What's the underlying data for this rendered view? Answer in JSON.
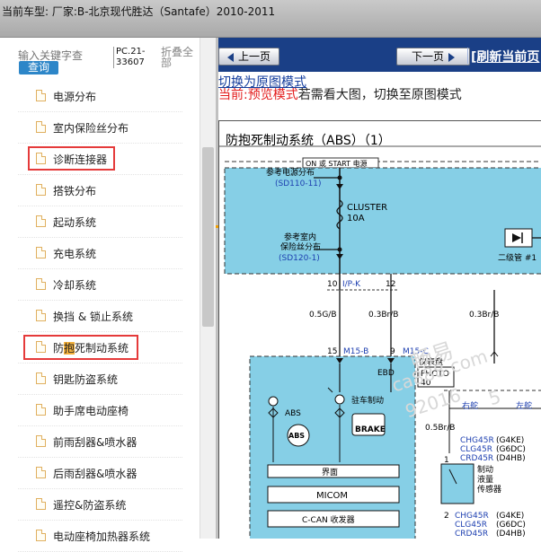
{
  "header": {
    "title": "当前车型:   厂家:B-北京现代胜达（Santafe）2010-2011"
  },
  "search": {
    "placeholder": "输入关键字查",
    "query_label": "查询",
    "pc_code": "PC.21-33607",
    "fold_label": "折叠全部"
  },
  "tree": {
    "items": [
      {
        "label": "电源分布"
      },
      {
        "label": "室内保险丝分布"
      },
      {
        "label": "诊断连接器"
      },
      {
        "label": "搭铁分布"
      },
      {
        "label": "起动系统"
      },
      {
        "label": "充电系统"
      },
      {
        "label": "冷却系统"
      },
      {
        "label": "换挡 & 锁止系统"
      },
      {
        "label_a": "防",
        "label_b": "抱",
        "label_c": "死制动系统"
      },
      {
        "label": "钥匙防盗系统"
      },
      {
        "label": "助手席电动座椅"
      },
      {
        "label": "前雨刮器&喷水器"
      },
      {
        "label": "后雨刮器&喷水器"
      },
      {
        "label": "遥控&防盗系统"
      },
      {
        "label": "电动座椅加热器系统"
      }
    ]
  },
  "nav": {
    "prev_label": "上一页",
    "next_label": "下一页",
    "refresh_label": "[刷新当前页"
  },
  "mode": {
    "link": "切换为原图模式",
    "current": "当前:",
    "preview": "预览模式",
    "hint": "若需看大图，切换至原图模式"
  },
  "diagram": {
    "title": "防抱死制动系统（ABS）（1）",
    "power_label": "ON 或 START 电源",
    "ref_power": "参考电源分布",
    "ref_power_code": "(SD110-11)",
    "cluster": "CLUSTER",
    "cluster_amp": "10A",
    "ref_fuse_1": "参考室内",
    "ref_fuse_2": "保险丝分布",
    "ref_fuse_code": "(SD120-1)",
    "diode": "二级管 #1",
    "pin_10": "10",
    "conn_ipk": "I/P-K",
    "pin_12": "12",
    "wire_05gb": "0.5G/B",
    "wire_03brb_1": "0.3Br/B",
    "wire_03brb_2": "0.3Br/B",
    "pin_15": "15",
    "conn_m15b": "M15-B",
    "pin_9": "9",
    "conn_m15c": "M15-C",
    "cluster_panel": "仪表盘",
    "photo": "PHOTO",
    "photo_no": "40",
    "ebd": "EBD",
    "brake_warn": "驻车制动",
    "abs": "ABS",
    "brake": "BRAKE",
    "right_rudder": "右舵",
    "left_rudder": "左舵",
    "wire_05brb": "0.5Br/B",
    "chg_1": "CHG45R",
    "chg_1_eng": "(G4KE)",
    "clg_1": "CLG45R",
    "clg_1_eng": "(G6DC)",
    "crd_1": "CRD45R",
    "crd_1_eng": "(D4HB)",
    "pin_1": "1",
    "sensor_1": "制动",
    "sensor_2": "液量",
    "sensor_3": "传感器",
    "interface": "界面",
    "micom": "MICOM",
    "ccan": "C-CAN 收发器",
    "pin_2": "2",
    "chg_2": "CHG45R",
    "chg_2_eng": "(G4KE)",
    "clg_2": "CLG45R",
    "clg_2_eng": "(G6DC)",
    "crd_2": "CRD45R",
    "crd_2_eng": "(D4HB)",
    "watermark_1": "畅易",
    "watermark_2": "ca888.com",
    "watermark_3": "92016",
    "watermark_4": "5"
  },
  "colors": {
    "accent": "#1a3f86",
    "highlight_box": "#e53a3a",
    "diagram_fill": "#86cfe6",
    "query_btn": "#2d86c8"
  }
}
